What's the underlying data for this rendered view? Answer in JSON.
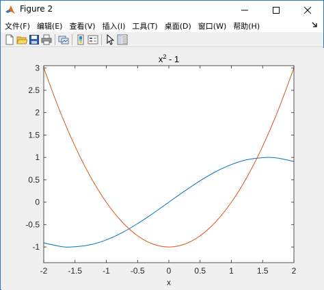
{
  "window": {
    "title": "Figure 2",
    "controls": {
      "minimize": "minimize",
      "maximize": "maximize",
      "close": "close"
    }
  },
  "menu": {
    "items": [
      "文件(F)",
      "编辑(E)",
      "查看(V)",
      "插入(I)",
      "工具(T)",
      "桌面(D)",
      "窗口(W)",
      "帮助(H)"
    ]
  },
  "toolbar": {
    "buttons": [
      "new-figure-icon",
      "open-file-icon",
      "save-icon",
      "print-icon",
      "link-plot-icon",
      "insert-colorbar-icon",
      "insert-legend-icon",
      "edit-plot-icon",
      "property-inspector-icon"
    ]
  },
  "colors": {
    "series_sin": "#0072bd",
    "series_parabola": "#d95319",
    "axes_bg": "#ffffff",
    "figure_bg": "#f0f0f0"
  },
  "chart_data": {
    "type": "line",
    "title_base": "x",
    "title_superscript": "2",
    "title_rest": " - 1",
    "xlabel": "x",
    "ylabel": "",
    "xlim": [
      -2,
      2
    ],
    "ylim": [
      -1.35,
      3.05
    ],
    "xticks": [
      -2,
      -1.5,
      -1,
      -0.5,
      0,
      0.5,
      1,
      1.5,
      2
    ],
    "xtick_labels": [
      "-2",
      "-1.5",
      "-1",
      "-0.5",
      "0",
      "0.5",
      "1",
      "1.5",
      "2"
    ],
    "yticks": [
      -1,
      -0.5,
      0,
      0.5,
      1,
      1.5,
      2,
      2.5,
      3
    ],
    "ytick_labels": [
      "-1",
      "-0.5",
      "0",
      "0.5",
      "1",
      "1.5",
      "2",
      "2.5",
      "3"
    ],
    "grid": false,
    "series": [
      {
        "color": "#0072bd",
        "x": [
          -2.0,
          -1.75,
          -1.5708,
          -1.25,
          -1.0,
          -0.75,
          -0.5,
          -0.25,
          0.0,
          0.25,
          0.5,
          0.75,
          1.0,
          1.25,
          1.5708,
          1.75,
          2.0
        ],
        "y": [
          -0.909,
          -0.984,
          -1.0,
          -0.949,
          -0.841,
          -0.682,
          -0.479,
          -0.247,
          0.0,
          0.247,
          0.479,
          0.682,
          0.841,
          0.949,
          1.0,
          0.984,
          0.909
        ]
      },
      {
        "color": "#d95319",
        "x": [
          -2.0,
          -1.75,
          -1.5,
          -1.25,
          -1.0,
          -0.75,
          -0.5,
          -0.25,
          0.0,
          0.25,
          0.5,
          0.75,
          1.0,
          1.25,
          1.5,
          1.75,
          2.0
        ],
        "y": [
          3.0,
          2.0625,
          1.25,
          0.5625,
          0.0,
          -0.4375,
          -0.75,
          -0.9375,
          -1.0,
          -0.9375,
          -0.75,
          -0.4375,
          0.0,
          0.5625,
          1.25,
          2.0625,
          3.0
        ]
      }
    ]
  }
}
